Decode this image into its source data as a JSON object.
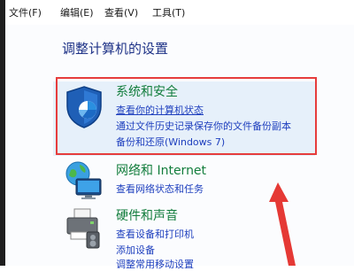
{
  "menubar": {
    "items": [
      {
        "label": "文件(F)"
      },
      {
        "label": "编辑(E)"
      },
      {
        "label": "查看(V)"
      },
      {
        "label": "工具(T)"
      }
    ]
  },
  "page": {
    "title": "调整计算机的设置"
  },
  "categories": [
    {
      "title": "系统和安全",
      "icon": "shield-icon",
      "links": [
        {
          "label": "查看你的计算机状态"
        },
        {
          "label": "通过文件历史记录保存你的文件备份副本"
        },
        {
          "label": "备份和还原(Windows 7)"
        }
      ]
    },
    {
      "title": "网络和 Internet",
      "icon": "network-globe-icon",
      "links": [
        {
          "label": "查看网络状态和任务"
        }
      ]
    },
    {
      "title": "硬件和声音",
      "icon": "printer-icon",
      "links": [
        {
          "label": "查看设备和打印机"
        },
        {
          "label": "添加设备"
        },
        {
          "label": "调整常用移动设置"
        }
      ]
    }
  ],
  "colors": {
    "category_title": "#127d3c",
    "link": "#1e3fbe",
    "page_title": "#1e3287",
    "highlight_border": "#e63c3c",
    "selected_bg": "#e6f0fa"
  }
}
